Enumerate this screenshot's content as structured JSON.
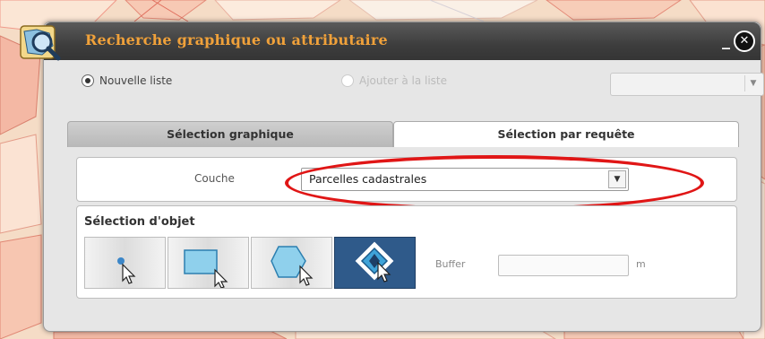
{
  "window": {
    "title": "Recherche graphique ou attributaire",
    "minimize_label": "_",
    "close_label": "✕"
  },
  "list_mode": {
    "options": [
      {
        "label": "Nouvelle liste",
        "selected": true,
        "enabled": true
      },
      {
        "label": "Ajouter à la liste",
        "selected": false,
        "enabled": false
      }
    ],
    "list_select_value": ""
  },
  "tabs": [
    {
      "label": "Sélection graphique",
      "active": false
    },
    {
      "label": "Sélection par requête",
      "active": true
    }
  ],
  "couche": {
    "label": "Couche",
    "selected": "Parcelles cadastrales"
  },
  "objet": {
    "title": "Sélection d'objet",
    "tools": [
      {
        "name": "point-select-tool",
        "icon": "pointer-icon",
        "active": false
      },
      {
        "name": "rectangle-select-tool",
        "icon": "rectangle-icon",
        "active": false
      },
      {
        "name": "polygon-select-tool",
        "icon": "polygon-icon",
        "active": false
      },
      {
        "name": "object-select-tool",
        "icon": "diamond-object-icon",
        "active": true
      }
    ],
    "buffer_label": "Buffer",
    "buffer_value": "",
    "buffer_unit": "m"
  },
  "colors": {
    "title": "#f0a13a",
    "highlight": "#e01616",
    "active_tool": "#2f5a8a"
  }
}
